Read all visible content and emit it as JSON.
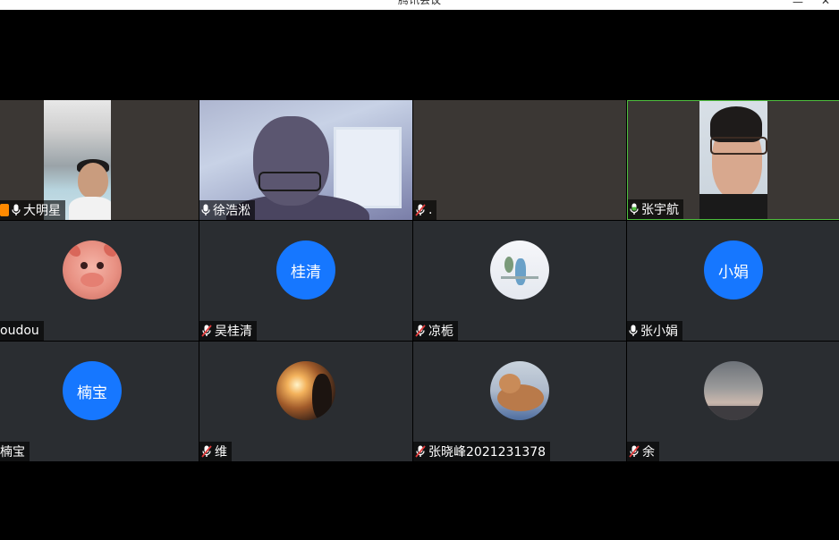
{
  "window": {
    "title": "腾讯会议",
    "minimize_glyph": "—",
    "close_glyph": "✕"
  },
  "colors": {
    "avatar_blue": "#1677ff",
    "active_speaker_border": "#4fbf3f",
    "muted_red": "#e23b3b",
    "tile_bg": "#2a2d31"
  },
  "participants": [
    {
      "name": "大明星",
      "mic": "on",
      "type": "video",
      "sharing": true
    },
    {
      "name": "徐浩淞",
      "mic": "on",
      "type": "video"
    },
    {
      "name": ".",
      "mic": "muted",
      "type": "no-video"
    },
    {
      "name": "张宇航",
      "mic": "on-active",
      "type": "video",
      "active": true
    },
    {
      "name": "oudou",
      "mic": "none",
      "type": "image-avatar",
      "avatar": "pig-avatar"
    },
    {
      "name": "吴桂清",
      "mic": "muted",
      "type": "text-avatar",
      "avatar_text": "桂清"
    },
    {
      "name": "凉栀",
      "mic": "muted",
      "type": "image-avatar",
      "avatar": "girl-desk-avatar"
    },
    {
      "name": "张小娟",
      "mic": "on",
      "type": "text-avatar",
      "avatar_text": "小娟"
    },
    {
      "name": "楠宝",
      "mic": "none",
      "type": "text-avatar",
      "avatar_text": "楠宝"
    },
    {
      "name": "维",
      "mic": "muted",
      "type": "image-avatar",
      "avatar": "sunset-avatar"
    },
    {
      "name": "张晓峰2021231378",
      "mic": "muted",
      "type": "image-avatar",
      "avatar": "cat-avatar"
    },
    {
      "name": "余",
      "mic": "muted",
      "type": "image-avatar",
      "avatar": "sky-avatar"
    }
  ]
}
